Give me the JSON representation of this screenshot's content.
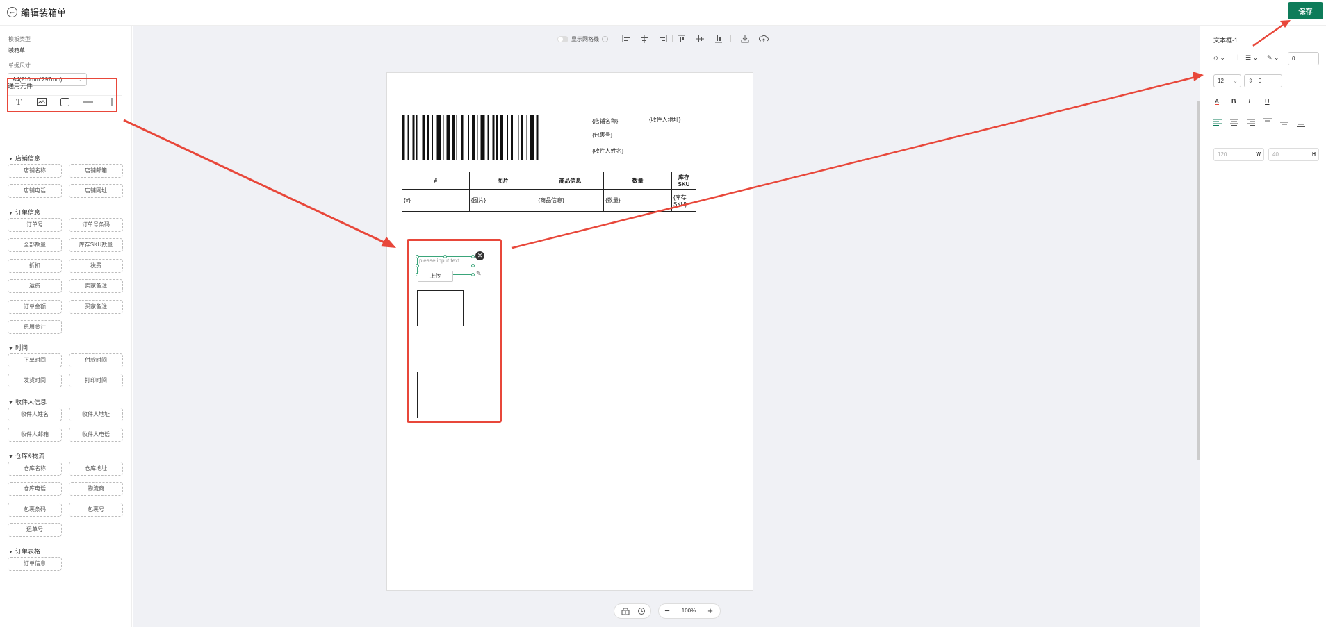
{
  "header": {
    "back_icon": "arrow-left-icon",
    "title": "编辑装箱单",
    "save_label": "保存"
  },
  "sidebar": {
    "template_type_label": "模板类型",
    "template_type_value": "装箱单",
    "paper_size_label": "单据尺寸",
    "paper_size_value": "A4(210mm*297mm)",
    "general_title": "通用元件",
    "general_tools": [
      "text-tool-icon",
      "image-tool-icon",
      "rect-tool-icon",
      "hline-tool-icon",
      "vline-tool-icon"
    ],
    "sections": [
      {
        "title": "店铺信息",
        "items": [
          "店铺名称",
          "店铺邮箱",
          "店铺电话",
          "店铺网址"
        ]
      },
      {
        "title": "订单信息",
        "items": [
          "订单号",
          "订单号条码",
          "全部数量",
          "库存SKU数量",
          "折扣",
          "税费",
          "运费",
          "卖家备注",
          "订单金额",
          "买家备注",
          "费用总计"
        ]
      },
      {
        "title": "时间",
        "items": [
          "下单时间",
          "付款时间",
          "发货时间",
          "打印时间"
        ]
      },
      {
        "title": "收件人信息",
        "items": [
          "收件人姓名",
          "收件人地址",
          "收件人邮箱",
          "收件人电话"
        ]
      },
      {
        "title": "仓库&物流",
        "items": [
          "仓库名称",
          "仓库地址",
          "仓库电话",
          "物流商",
          "包裹条码",
          "包裹号",
          "运单号"
        ]
      },
      {
        "title": "订单表格",
        "items": [
          "订单信息"
        ]
      }
    ]
  },
  "canvas": {
    "grid_toggle_label": "显示网格线",
    "paper": {
      "placeholders": {
        "store_name": "{店铺名称}",
        "recipient_address": "{收件人地址}",
        "package_no": "{包裹号}",
        "recipient_name": "{收件人姓名}"
      },
      "table": {
        "headers": [
          "#",
          "图片",
          "商品信息",
          "数量",
          "库存SKU"
        ],
        "row": [
          "{#}",
          "{图片}",
          "{商品信息}",
          "{数量}",
          "{库存SKU}"
        ]
      },
      "textbox_placeholder": "please input text",
      "upload_label": "上传"
    },
    "zoom": {
      "minus": "−",
      "value": "100%",
      "plus": "+"
    }
  },
  "properties": {
    "element_title": "文本框-1",
    "border_width": "0",
    "font_size": "12",
    "line_height": "0",
    "format_buttons": [
      "A",
      "B",
      "I",
      "U"
    ],
    "width": "120",
    "width_unit": "W",
    "height": "40",
    "height_unit": "H"
  },
  "colors": {
    "accent": "#0e7c5a",
    "annotation": "#e8473a",
    "selection": "#3aa57a"
  }
}
